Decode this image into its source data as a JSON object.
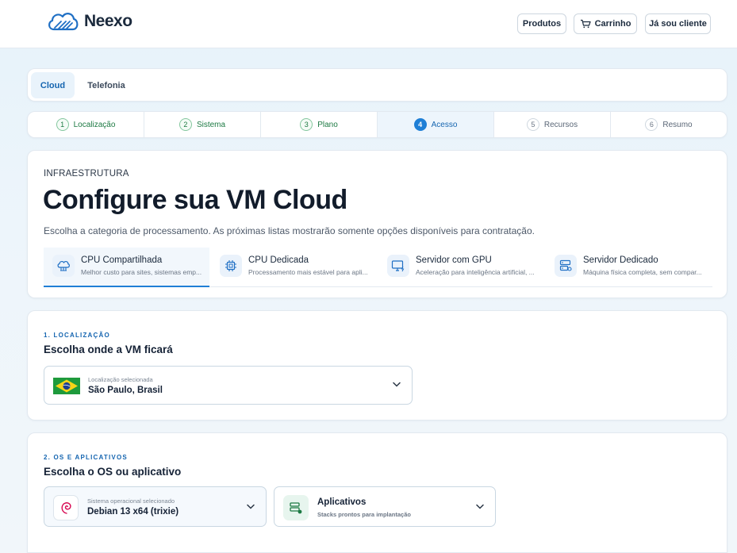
{
  "header": {
    "logo_text": "Neexo",
    "buttons": {
      "produtos": "Produtos",
      "carrinho": "Carrinho",
      "cliente": "Já sou cliente"
    }
  },
  "tabs": [
    {
      "label": "Cloud",
      "active": true
    },
    {
      "label": "Telefonia",
      "active": false
    }
  ],
  "steps": [
    {
      "num": "1",
      "label": "Localização",
      "state": "done"
    },
    {
      "num": "2",
      "label": "Sistema",
      "state": "done"
    },
    {
      "num": "3",
      "label": "Plano",
      "state": "done"
    },
    {
      "num": "4",
      "label": "Acesso",
      "state": "active"
    },
    {
      "num": "5",
      "label": "Recursos",
      "state": "pending"
    },
    {
      "num": "6",
      "label": "Resumo",
      "state": "pending"
    }
  ],
  "hero": {
    "eyebrow": "INFRAESTRUTURA",
    "title": "Configure sua VM Cloud",
    "subtitle": "Escolha a categoria de processamento. As próximas listas mostrarão somente opções disponíveis para contratação.",
    "categories": [
      {
        "name": "CPU Compartilhada",
        "desc": "Melhor custo para sites, sistemas emp...",
        "icon": "cloud-network-icon",
        "active": true
      },
      {
        "name": "CPU Dedicada",
        "desc": "Processamento mais estável para apli...",
        "icon": "cpu-chip-icon",
        "active": false
      },
      {
        "name": "Servidor com GPU",
        "desc": "Aceleração para inteligência artificial, ...",
        "icon": "monitor-gpu-icon",
        "active": false
      },
      {
        "name": "Servidor Dedicado",
        "desc": "Máquina física completa, sem compar...",
        "icon": "server-rack-icon",
        "active": false
      }
    ]
  },
  "location": {
    "eyebrow": "1. LOCALIZAÇÃO",
    "title": "Escolha onde a VM ficará",
    "select_small": "Localização selecionada",
    "select_value": "São Paulo, Brasil",
    "flag": "brazil-flag-icon"
  },
  "os": {
    "eyebrow": "2. OS E APLICATIVOS",
    "title": "Escolha o OS ou aplicativo",
    "os_small": "Sistema operacional selecionado",
    "os_value": "Debian 13 x64 (trixie)",
    "app_title": "Aplicativos",
    "app_sub": "Stacks prontos para implantação"
  },
  "colors": {
    "accent": "#1f7fd6",
    "accent_text": "#1565b0",
    "done_green": "#1d7a43",
    "debian_red": "#d70751"
  }
}
